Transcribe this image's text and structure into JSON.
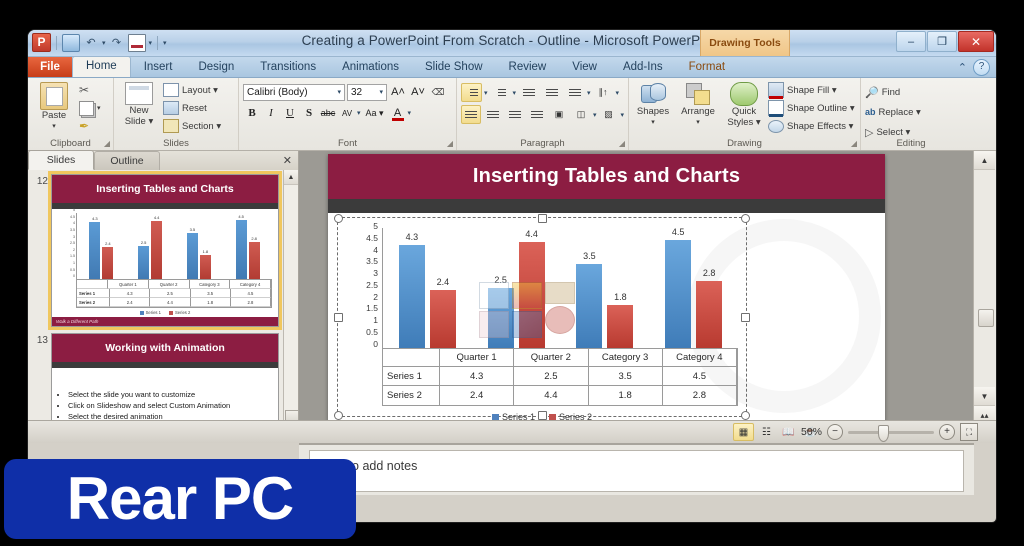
{
  "window": {
    "title": "Creating a PowerPoint From Scratch - Outline - Microsoft PowerPoint",
    "contextual_tab": "Drawing Tools",
    "minimize": "–",
    "restore": "❐",
    "close": "✕"
  },
  "quick_access": {
    "logo": "P",
    "save": "save-icon",
    "undo": "↶",
    "redo": "↷",
    "slideshow": "slideshow-icon",
    "dropdown": "▾"
  },
  "tabs": [
    {
      "label": "File",
      "active": false
    },
    {
      "label": "Home",
      "active": true
    },
    {
      "label": "Insert",
      "active": false
    },
    {
      "label": "Design",
      "active": false
    },
    {
      "label": "Transitions",
      "active": false
    },
    {
      "label": "Animations",
      "active": false
    },
    {
      "label": "Slide Show",
      "active": false
    },
    {
      "label": "Review",
      "active": false
    },
    {
      "label": "View",
      "active": false
    },
    {
      "label": "Add-Ins",
      "active": false
    },
    {
      "label": "Format",
      "active": false
    }
  ],
  "help": {
    "minimize_ribbon": "⌃",
    "help": "?"
  },
  "ribbon": {
    "clipboard": {
      "name": "Clipboard",
      "paste": "Paste",
      "paste_caret": "▾",
      "cut": "✂",
      "copy": "copy-icon",
      "format_painter": "✒",
      "dialog": "◢"
    },
    "slides": {
      "name": "Slides",
      "new_slide": "New Slide ▾",
      "new_slide_l1": "New",
      "new_slide_l2": "Slide ▾",
      "layout": "Layout ▾",
      "reset": "Reset",
      "section": "Section ▾"
    },
    "font": {
      "name": "Font",
      "family": "Calibri (Body)",
      "size": "32",
      "grow": "A˄",
      "shrink": "A˅",
      "clear_formatting": "clear-formatting-icon",
      "bold": "B",
      "italic": "I",
      "underline": "U",
      "shadow": "S",
      "strikethrough": "abc",
      "spacing": "AV",
      "change_case": "Aa ▾",
      "font_color": "A",
      "caret": "▾",
      "dialog": "◢"
    },
    "paragraph": {
      "name": "Paragraph",
      "bullets": "bullets-icon",
      "numbering": "numbering-icon",
      "decrease_indent": "decrease-indent-icon",
      "increase_indent": "increase-indent-icon",
      "line_spacing": "line-spacing-icon",
      "text_direction": "text-direction-icon",
      "align_text": "align-text-icon",
      "convert_smartart": "smartart-icon",
      "align_left": "align-left-icon",
      "align_center": "align-center-icon",
      "align_right": "align-right-icon",
      "justify": "justify-icon",
      "columns": "columns-icon",
      "caret": "▾",
      "dialog": "◢"
    },
    "drawing": {
      "name": "Drawing",
      "shapes": "Shapes",
      "arrange": "Arrange",
      "quick_styles_l1": "Quick",
      "quick_styles_l2": "Styles ▾",
      "caret": "▾",
      "shape_fill": "Shape Fill ▾",
      "shape_outline": "Shape Outline ▾",
      "shape_effects": "Shape Effects ▾",
      "dialog": "◢"
    },
    "editing": {
      "name": "Editing",
      "find": "Find",
      "replace": "Replace ▾",
      "select": "Select ▾"
    }
  },
  "slides_panel": {
    "tab_slides": "Slides",
    "tab_outline": "Outline",
    "close": "✕",
    "scroll_up": "▲",
    "scroll_down": "▼",
    "thumbnails": [
      {
        "number": "12",
        "title": "Inserting Tables and Charts",
        "selected": true,
        "footer": "Walk a Different Path"
      },
      {
        "number": "13",
        "title": "Working with Animation",
        "selected": false,
        "bullets": [
          "Select the slide you want to customize",
          "Click on Slideshow and select Custom Animation",
          "Select the desired animation"
        ]
      }
    ]
  },
  "slide": {
    "title": "Inserting Tables and Charts",
    "footer": "Walk a Different Path",
    "clipart_placeholder": "insert-object-icons"
  },
  "chart_data": {
    "type": "bar",
    "title": "",
    "categories": [
      "Quarter 1",
      "Quarter 2",
      "Category 3",
      "Category 4"
    ],
    "series": [
      {
        "name": "Series 1",
        "values": [
          4.3,
          2.5,
          3.5,
          4.5
        ],
        "color": "#4f81bd"
      },
      {
        "name": "Series 2",
        "values": [
          2.4,
          4.4,
          1.8,
          2.8
        ],
        "color": "#c0504d"
      }
    ],
    "yticks": [
      "5",
      "4.5",
      "4",
      "3.5",
      "3",
      "2.5",
      "2",
      "1.5",
      "1",
      "0.5",
      "0"
    ],
    "ylim": [
      0,
      5
    ],
    "xlabel": "",
    "ylabel": "",
    "grid": false,
    "legend_position": "bottom",
    "data_table_visible": true,
    "data_labels_visible": true
  },
  "notes": {
    "placeholder": "Click to add notes"
  },
  "status_bar": {
    "view_normal": "normal-view-icon",
    "view_slide_sorter": "slide-sorter-icon",
    "view_reading": "reading-view-icon",
    "view_slideshow": "slideshow-view-icon",
    "zoom_level": "50%",
    "zoom_out": "−",
    "zoom_in": "+",
    "fit_to_window": "fit-window-icon"
  },
  "scrollbars": {
    "up": "▲",
    "down": "▼",
    "prev_slide": "▴▴",
    "next_slide": "▾▾"
  },
  "watermark": {
    "text": "Rear PC",
    "color": "#0f2fa8"
  }
}
